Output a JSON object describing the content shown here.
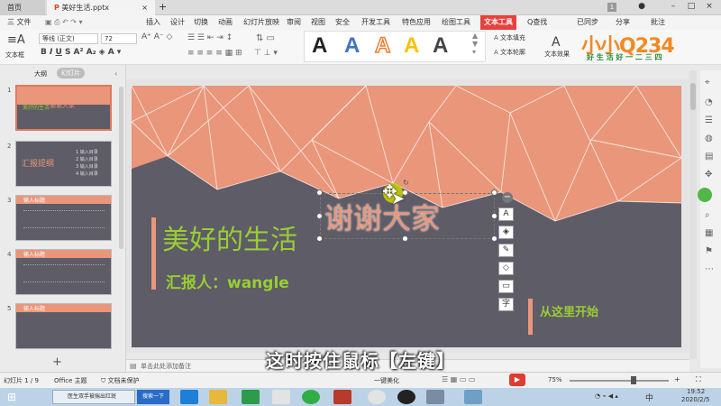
{
  "titlebar": {
    "home_tab": "首页",
    "file_tab": "美好生活.pptx",
    "badge": "1"
  },
  "menubar": {
    "file_menu": "三 文件",
    "items": [
      "插入",
      "设计",
      "切换",
      "动画",
      "幻灯片放映",
      "审阅",
      "视图",
      "开发工具",
      "特色应用",
      "绘图工具",
      "文本工具"
    ],
    "find": "Q查找",
    "sync": "已同步",
    "share": "分享",
    "comment": "批注"
  },
  "ribbon": {
    "textbox_label": "文本框",
    "font_name": "等线 (正文)",
    "font_size": "72",
    "fill_label": "文本填充",
    "outline_label": "文本轮廓",
    "effect_label": "文本效果",
    "styles": [
      "A",
      "A",
      "A",
      "A",
      "A"
    ],
    "style_colors": [
      "#222222",
      "#4472c4",
      "#ed7d31",
      "#ffc000",
      "#444444"
    ]
  },
  "watermark": {
    "logo": "小小Q234",
    "sub": "好 生 活 好 一 二 三 四"
  },
  "leftpane": {
    "outline_tab": "大纲",
    "slides_tab": "幻灯片",
    "slides": [
      {
        "num": "1",
        "title": "谢谢大家",
        "sub": "美好的生活"
      },
      {
        "num": "2",
        "title": "汇报提纲",
        "items": [
          "1 输入目录",
          "2 输入目录",
          "3 输入目录",
          "4 输入目录"
        ]
      },
      {
        "num": "3",
        "title": "输入标题"
      },
      {
        "num": "4",
        "title": "输入标题"
      },
      {
        "num": "5",
        "title": "输入标题"
      }
    ],
    "add_button": "+"
  },
  "slide": {
    "title": "美好的生活",
    "reporter": "汇报人：wangle",
    "thanks": "谢谢大家",
    "start": "从这里开始"
  },
  "notes": {
    "placeholder": "单击此处添加备注"
  },
  "statusbar": {
    "slide_count": "幻灯片 1 / 9",
    "theme": "Office 主题",
    "protect": "文档未保护",
    "beautify": "一键美化",
    "zoom": "75%"
  },
  "subtitle": "这时按住鼠标【左键】",
  "taskbar": {
    "item1": "医生双手被揣出红斑",
    "search": "搜索一下",
    "time": "19:52",
    "date": "2020/2/5",
    "ime": "中"
  }
}
